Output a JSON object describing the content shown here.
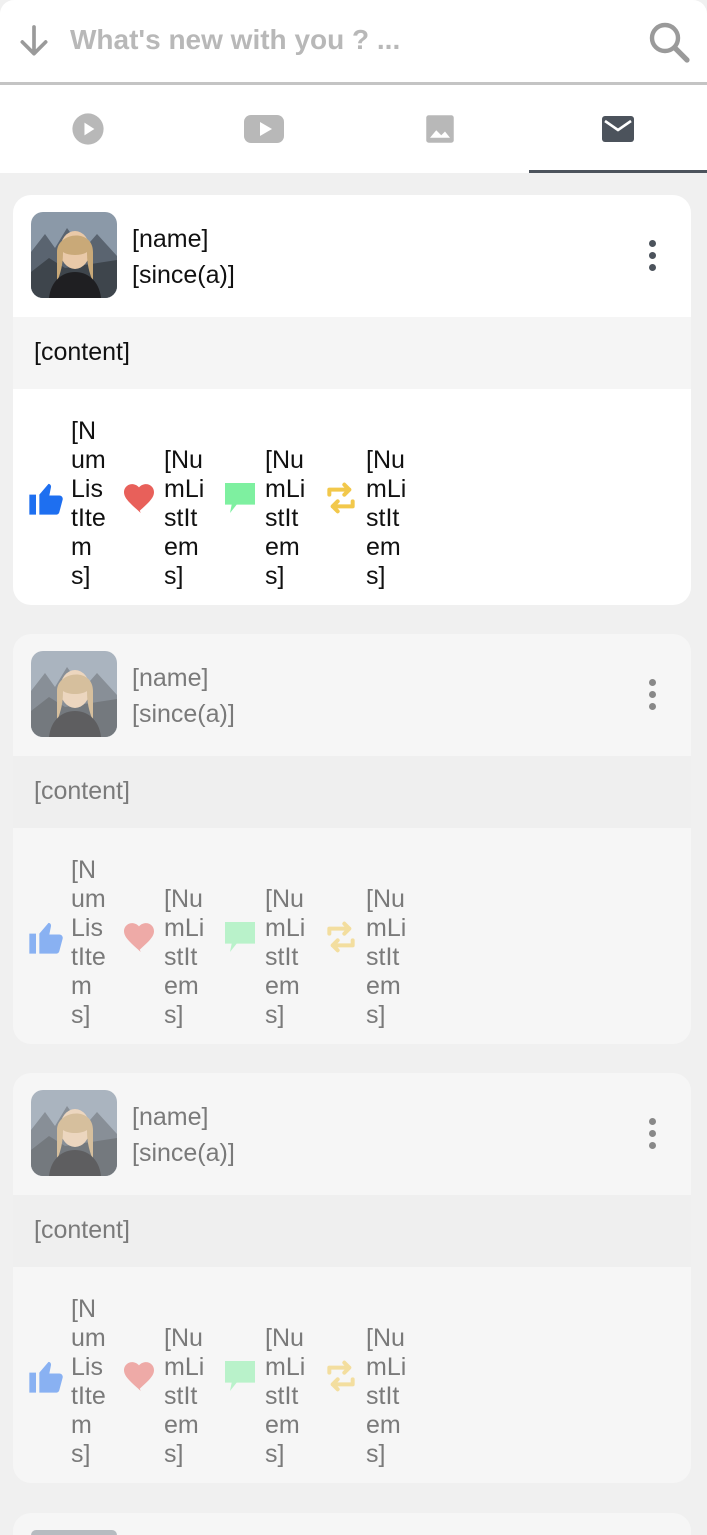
{
  "search": {
    "placeholder": "What's new with you ? ..."
  },
  "tabs": [
    {
      "icon": "play-circle-icon",
      "active": false
    },
    {
      "icon": "youtube-icon",
      "active": false
    },
    {
      "icon": "image-icon",
      "active": false
    },
    {
      "icon": "mail-icon",
      "active": true
    }
  ],
  "posts": [
    {
      "name": "[name]",
      "since": "[since(a)]",
      "content": "[content]",
      "likes": "[NumListItems]",
      "hearts": "[NumListItems]",
      "comments": "[NumListItems]",
      "reposts": "[NumListItems]"
    },
    {
      "name": "[name]",
      "since": "[since(a)]",
      "content": "[content]",
      "likes": "[NumListItems]",
      "hearts": "[NumListItems]",
      "comments": "[NumListItems]",
      "reposts": "[NumListItems]"
    },
    {
      "name": "[name]",
      "since": "[since(a)]",
      "content": "[content]",
      "likes": "[NumListItems]",
      "hearts": "[NumListItems]",
      "comments": "[NumListItems]",
      "reposts": "[NumListItems]"
    }
  ],
  "colors": {
    "like": "#1e6ff0",
    "heart": "#e8605a",
    "comment": "#7ef0a0",
    "repost": "#f2c84b",
    "tab_inactive": "#b8b8b8",
    "tab_active": "#4c535c"
  }
}
